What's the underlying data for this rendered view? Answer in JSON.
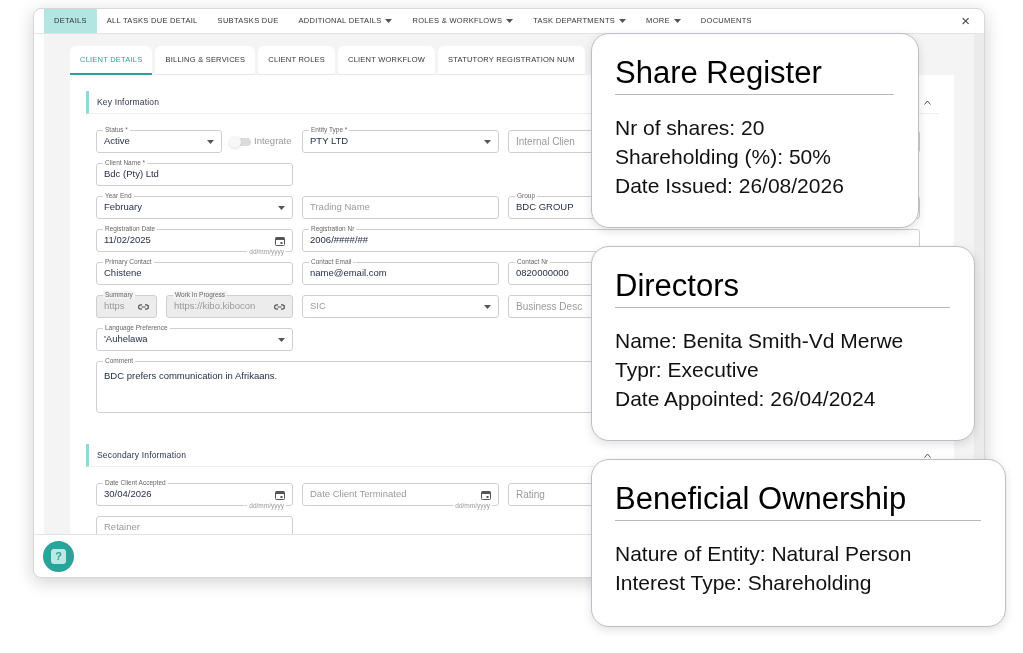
{
  "nav_tabs": [
    {
      "label": "DETAILS",
      "selected": true,
      "has_menu": false
    },
    {
      "label": "ALL TASKS DUE DETAIL",
      "selected": false,
      "has_menu": false
    },
    {
      "label": "SUBTASKS DUE",
      "selected": false,
      "has_menu": false
    },
    {
      "label": "ADDITIONAL DETAILS",
      "selected": false,
      "has_menu": true
    },
    {
      "label": "ROLES & WORKFLOWS",
      "selected": false,
      "has_menu": true
    },
    {
      "label": "TASK DEPARTMENTS",
      "selected": false,
      "has_menu": true
    },
    {
      "label": "MORE",
      "selected": false,
      "has_menu": true
    },
    {
      "label": "DOCUMENTS",
      "selected": false,
      "has_menu": false
    }
  ],
  "close": "×",
  "sub_tabs": [
    {
      "label": "CLIENT DETAILS",
      "selected": true
    },
    {
      "label": "BILLING & SERVICES",
      "selected": false
    },
    {
      "label": "CLIENT ROLES",
      "selected": false
    },
    {
      "label": "CLIENT WORKFLOW",
      "selected": false
    },
    {
      "label": "STATUTORY REGISTRATION NUM",
      "selected": false
    }
  ],
  "sections": [
    {
      "title": "Key Information",
      "expanded": true,
      "rows": [
        [
          {
            "kind": "select",
            "label": "Status *",
            "value": "Active"
          },
          {
            "kind": "toggle",
            "label": "Integrate",
            "on": false
          },
          {
            "kind": "select",
            "label": "Entity Type *",
            "value": "PTY LTD"
          },
          {
            "kind": "text",
            "placeholder": "Internal Clien"
          }
        ],
        [
          {
            "kind": "text",
            "label": "Client Name *",
            "value": "Bdc  (Pty) Ltd"
          }
        ],
        [
          {
            "kind": "select",
            "label": "Year End",
            "value": "February"
          },
          {
            "kind": "text",
            "placeholder": "Trading Name"
          },
          {
            "kind": "text",
            "label": "Group",
            "value": "BDC GROUP"
          }
        ],
        [
          {
            "kind": "date",
            "label": "Registration Date",
            "value": "11/02/2025",
            "hint": "dd/mm/yyyy"
          },
          {
            "kind": "text",
            "label": "Registration Nr",
            "value": "2006/####/##"
          }
        ],
        [
          {
            "kind": "text",
            "label": "Primary Contact",
            "value": "Chistene"
          },
          {
            "kind": "text",
            "label": "Contact Email",
            "value": "name@email.com"
          },
          {
            "kind": "text",
            "label": "Contact Nr",
            "value": "0820000000"
          }
        ],
        [
          {
            "kind": "link",
            "label": "Summary",
            "value": "https",
            "disabled": true
          },
          {
            "kind": "link",
            "label": "Work In Progress",
            "value": "https://kibo.kibocon",
            "disabled": true
          },
          {
            "kind": "select",
            "placeholder": "SIC"
          },
          {
            "kind": "text",
            "placeholder": "Business Desc"
          }
        ],
        [
          {
            "kind": "select",
            "label": "Language Preference",
            "value": "'Auhelawa"
          }
        ],
        [
          {
            "kind": "textarea",
            "label": "Comment",
            "value": "BDC prefers communication in Afrikaans."
          }
        ]
      ]
    },
    {
      "title": "Secondary Information",
      "expanded": true,
      "rows": [
        [
          {
            "kind": "date",
            "label": "Date Client Accepted",
            "value": "30/04/2026",
            "hint": "dd/mm/yyyy"
          },
          {
            "kind": "date",
            "placeholder": "Date Client Terminated",
            "hint": "dd/mm/yyyy"
          },
          {
            "kind": "text",
            "placeholder": "Rating"
          }
        ],
        [
          {
            "kind": "text",
            "placeholder": "Retainer"
          }
        ]
      ]
    }
  ],
  "help_button": {
    "icon_text": "?"
  },
  "cards": [
    {
      "title": "Share Register",
      "lines": [
        "Nr of shares: 20",
        "Shareholding (%): 50%",
        "Date Issued: 26/08/2026"
      ]
    },
    {
      "title": "Directors",
      "lines": [
        "Name: Benita Smith-Vd Merwe",
        "Typr: Executive",
        "Date Appointed: 26/04/2024"
      ]
    },
    {
      "title": "Beneficial Ownership",
      "lines": [
        "Nature of Entity: Natural Person",
        "Interest Type: Shareholding"
      ]
    }
  ]
}
